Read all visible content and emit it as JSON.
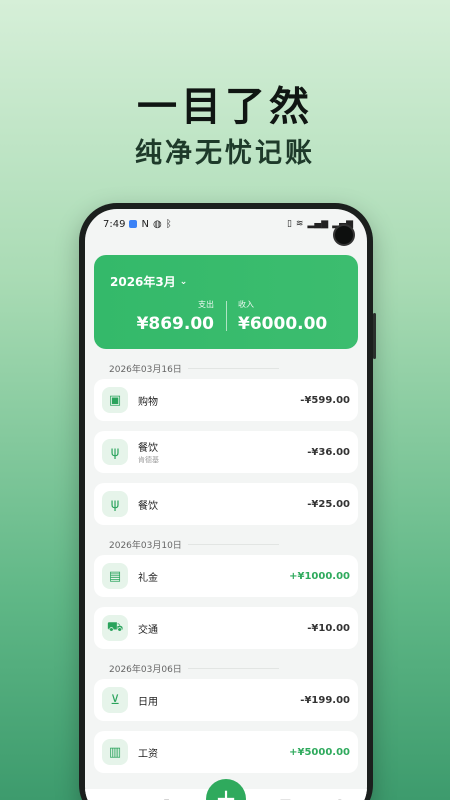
{
  "hero": {
    "title": "一目了然",
    "subtitle": "纯净无忧记账"
  },
  "status_bar": {
    "time": "7:49",
    "left_icons": [
      "notification-icon",
      "nfc-icon",
      "silent-icon",
      "bluetooth-icon"
    ],
    "right_icons": [
      "vibrate-icon",
      "wifi-icon",
      "signal-icon",
      "signal-icon",
      "battery-icon"
    ]
  },
  "summary": {
    "month": "2026年3月",
    "expense_label": "支出",
    "expense_value": "¥869.00",
    "income_label": "收入",
    "income_value": "¥6000.00",
    "color": "#34b96a"
  },
  "groups": [
    {
      "date": "2026年03月16日",
      "items": [
        {
          "category": "购物",
          "note": "",
          "amount": "-¥599.00",
          "icon": "shopping-bag-icon"
        },
        {
          "category": "餐饮",
          "note": "肯德基",
          "amount": "-¥36.00",
          "icon": "dining-icon"
        },
        {
          "category": "餐饮",
          "note": "",
          "amount": "-¥25.00",
          "icon": "dining-icon"
        }
      ]
    },
    {
      "date": "2026年03月10日",
      "items": [
        {
          "category": "礼金",
          "note": "",
          "amount": "+¥1000.00",
          "icon": "wallet-icon"
        },
        {
          "category": "交通",
          "note": "",
          "amount": "-¥10.00",
          "icon": "car-icon"
        }
      ]
    },
    {
      "date": "2026年03月06日",
      "items": [
        {
          "category": "日用",
          "note": "",
          "amount": "-¥199.00",
          "icon": "cart-icon"
        },
        {
          "category": "工资",
          "note": "",
          "amount": "+¥5000.00",
          "icon": "cash-icon"
        }
      ]
    }
  ],
  "tabbar": {
    "add_label": "+",
    "active": "home"
  }
}
